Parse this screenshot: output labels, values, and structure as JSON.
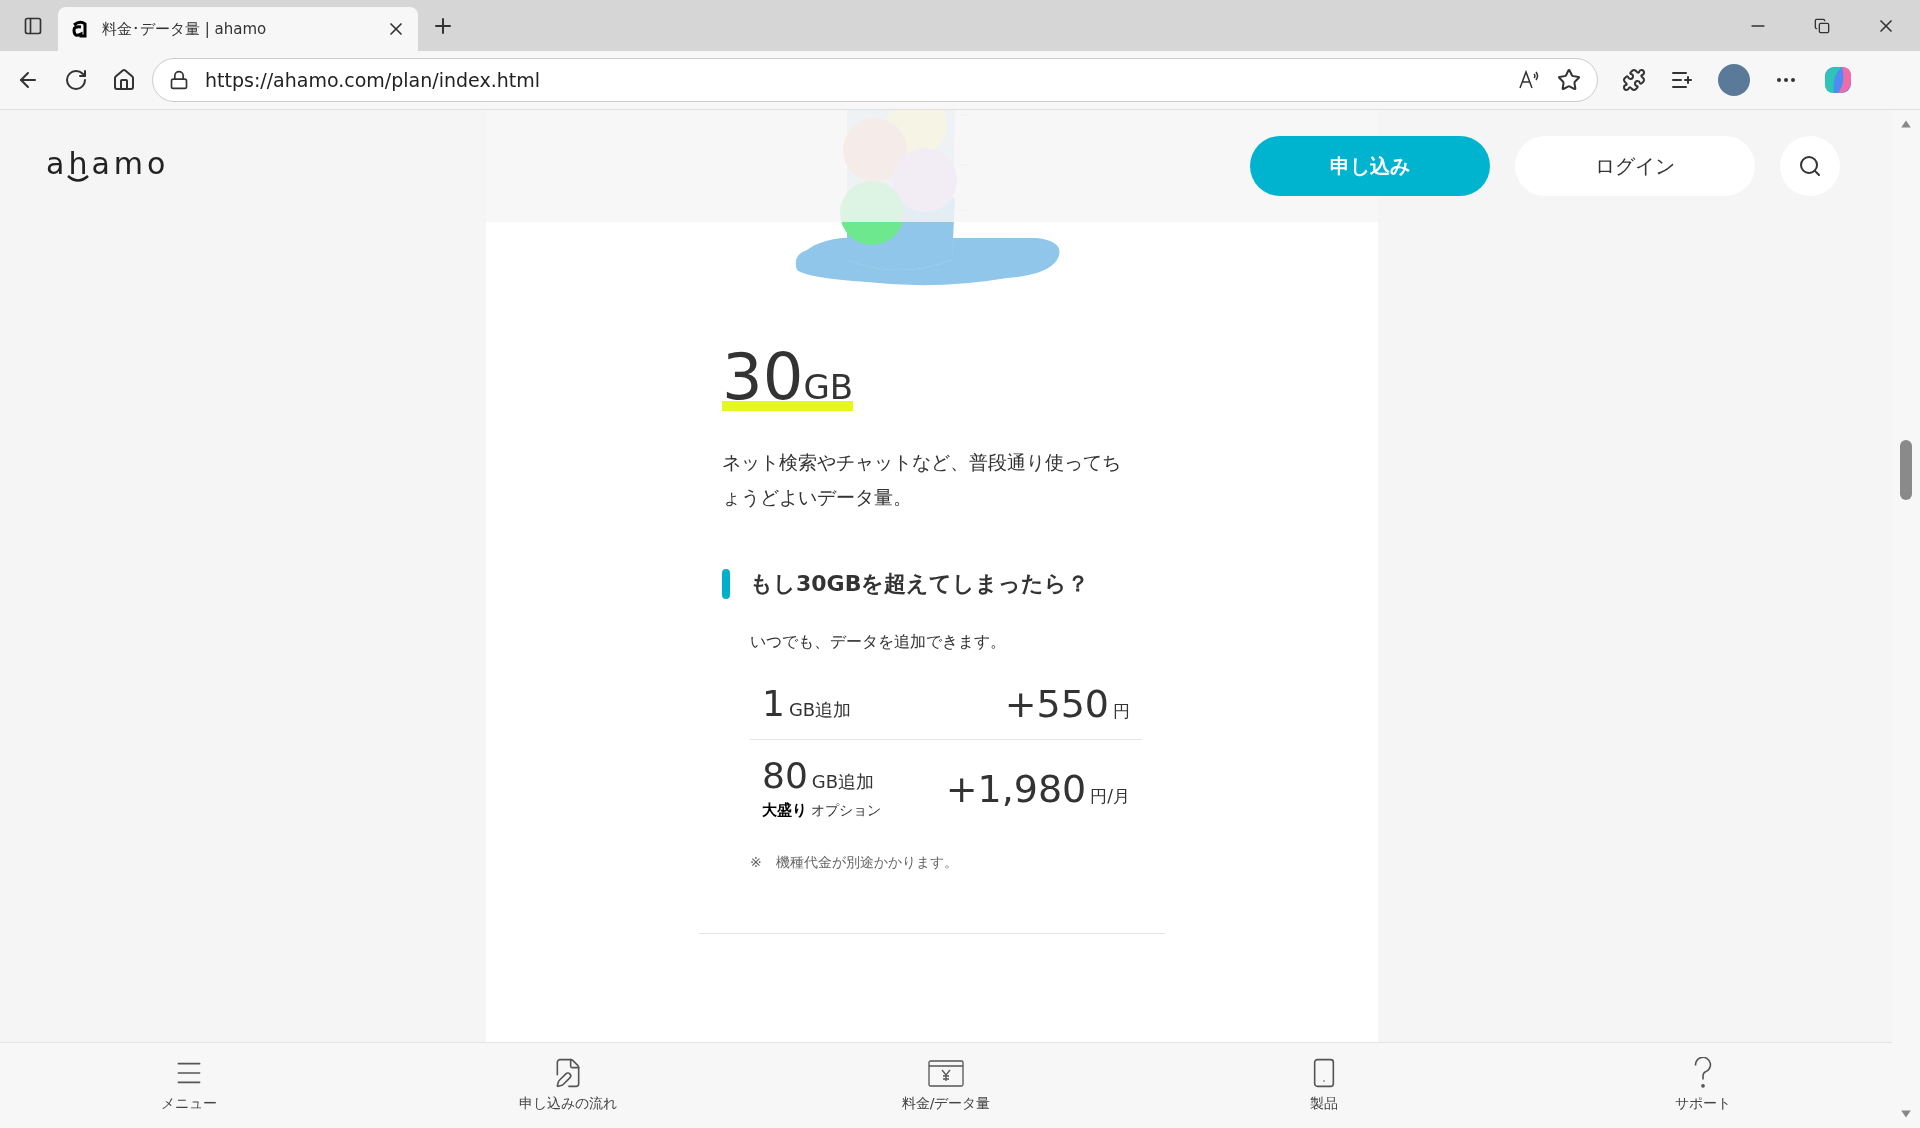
{
  "browser": {
    "tab_title": "料金･データ量 | ahamo",
    "url": "https://ahamo.com/plan/index.html"
  },
  "header": {
    "logo": "ahamo",
    "buttons": [
      {
        "label": "申し込み",
        "kind": "primary"
      },
      {
        "label": "ログイン",
        "kind": "secondary"
      }
    ]
  },
  "plan": {
    "amount": "30",
    "unit": "GB",
    "description": "ネット検索やチャットなど、普段通り使ってちょうどよいデータ量。",
    "overage": {
      "heading": "もし30GBを超えてしまったら？",
      "lead": "いつでも、データを追加できます。",
      "options": [
        {
          "amount": "1",
          "unit": "GB追加",
          "price": "+550",
          "price_unit": "円"
        },
        {
          "amount": "80",
          "unit": "GB追加",
          "tag": "大盛り",
          "tag_note": "オプション",
          "price": "+1,980",
          "price_unit": "円/月"
        }
      ],
      "note": "※　機種代金が別途かかります。"
    }
  },
  "bottom_nav": [
    {
      "label": "メニュー",
      "kind": "menu"
    },
    {
      "label": "申し込みの流れ",
      "kind": "flow"
    },
    {
      "label": "料金/データ量",
      "kind": "price"
    },
    {
      "label": "製品",
      "kind": "device"
    },
    {
      "label": "サポート",
      "kind": "support"
    }
  ]
}
